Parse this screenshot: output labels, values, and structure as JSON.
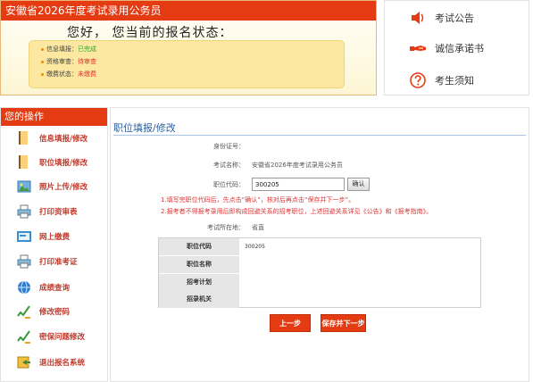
{
  "status_panel": {
    "title": "安徽省2026年度考试录用公务员",
    "greeting": "您好， 您当前的报名状态：",
    "rows": [
      {
        "label": "信息填报：",
        "value": "已完成"
      },
      {
        "label": "资格审查：",
        "value": "待审查"
      },
      {
        "label": "缴费状态：",
        "value": "未缴费"
      }
    ]
  },
  "links": [
    {
      "label": "考试公告",
      "icon": "speaker-icon"
    },
    {
      "label": "诚信承诺书",
      "icon": "handshake-icon"
    },
    {
      "label": "考生须知",
      "icon": "question-icon"
    }
  ],
  "sidebar": {
    "title": "您的操作",
    "items": [
      {
        "label": "信息填报/修改",
        "icon": "book-icon"
      },
      {
        "label": "职位填报/修改",
        "icon": "book-icon"
      },
      {
        "label": "照片上传/修改",
        "icon": "photo-upload-icon"
      },
      {
        "label": "打印资审表",
        "icon": "printer-icon"
      },
      {
        "label": "网上缴费",
        "icon": "payment-icon"
      },
      {
        "label": "打印准考证",
        "icon": "printer-icon"
      },
      {
        "label": "成绩查询",
        "icon": "globe-icon"
      },
      {
        "label": "修改密码",
        "icon": "pencil-icon"
      },
      {
        "label": "密保问题修改",
        "icon": "pencil-icon"
      },
      {
        "label": "退出报名系统",
        "icon": "exit-icon"
      }
    ]
  },
  "form": {
    "title": "职位填报/修改",
    "id_label": "身份证号：",
    "id_value": "",
    "exam_label": "考试名称：",
    "exam_value": "安徽省2026年度考试录用公务员",
    "code_label": "职位代码：",
    "code_value": "300205",
    "confirm_label": "确认",
    "notes": [
      "1.填写完职位代码后，先点击“确认”，核对后再点击“保存并下一步”。",
      "2.报考者不得报考录用后即构成回避关系的招考职位，上述回避关系详见《公告》和《报考指南》。"
    ],
    "location_label": "考试所在地：",
    "location_value": "省直",
    "table": [
      {
        "header": "职位代码",
        "value": "300205"
      },
      {
        "header": "职位名称",
        "value": ""
      },
      {
        "header": "招考计划",
        "value": ""
      },
      {
        "header": "招录机关",
        "value": ""
      }
    ],
    "prev_label": "上一步",
    "save_label": "保存并下一步"
  },
  "colors": {
    "accent": "#e43b12",
    "done": "#2da52d",
    "warning": "#e23232",
    "title_blue": "#2a5e9c"
  }
}
